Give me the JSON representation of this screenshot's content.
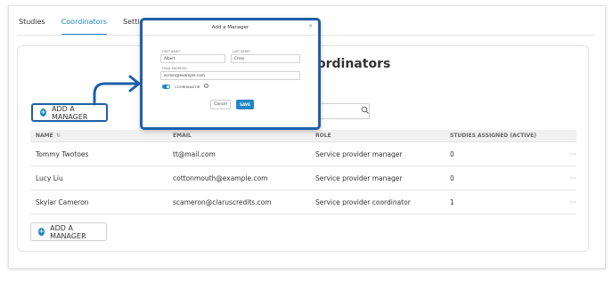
{
  "tabs": [
    {
      "label": "Studies"
    },
    {
      "label": "Coordinators"
    },
    {
      "label": "Settings"
    }
  ],
  "page": {
    "heading": "ordinators"
  },
  "add_button_label": "ADD A MANAGER",
  "table": {
    "headers": [
      "NAME",
      "EMAIL",
      "ROLE",
      "STUDIES ASSIGNED (ACTIVE)"
    ],
    "rows": [
      {
        "name": "Tommy Twotoes",
        "email": "tt@mail.com",
        "role": "Service provider manager",
        "studies": "0",
        "menu": "···"
      },
      {
        "name": "Lucy Liu",
        "email": "cottonmouth@example.com",
        "role": "Service provider manager",
        "studies": "0",
        "menu": "···"
      },
      {
        "name": "Skylar Cameron",
        "email": "scameron@claruscredits.com",
        "role": "Service provider coordinator",
        "studies": "1",
        "menu": "···"
      }
    ]
  },
  "modal": {
    "title": "Add a Manager",
    "close": "×",
    "first_name_label": "FIRST NAME*",
    "first_name_value": "Albert",
    "last_name_label": "LAST NAME*",
    "last_name_value": "Cross",
    "email_label": "EMAIL ADDRESS*",
    "email_value": "across@example.com",
    "coordinator_label": "COORDINATOR",
    "info": "i",
    "cancel": "Cancel",
    "save": "SAVE"
  },
  "colors": {
    "accent": "#1f86c6",
    "highlight": "#1f5fa8"
  },
  "icons": {
    "search": "search-icon",
    "plus": "plus-icon",
    "sort": "sort-icon",
    "more": "more-icon"
  }
}
